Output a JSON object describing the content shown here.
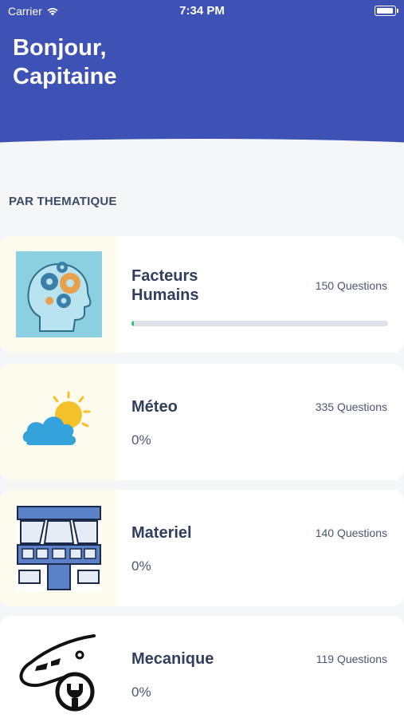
{
  "status_bar": {
    "carrier": "Carrier",
    "time": "7:34 PM"
  },
  "header": {
    "greeting": "Bonjour,\nCapitaine"
  },
  "section": {
    "label": "PAR THEMATIQUE"
  },
  "themes": [
    {
      "title": "Facteurs\nHumains",
      "count": "150 Questions",
      "progress": 0.01,
      "icon": "human-factors-gears-head-icon"
    },
    {
      "title": "Méteo",
      "count": "335 Questions",
      "percent": "0%",
      "icon": "weather-sun-cloud-icon"
    },
    {
      "title": "Materiel",
      "count": "140 Questions",
      "percent": "0%",
      "icon": "cockpit-icon"
    },
    {
      "title": "Mecanique",
      "count": "119 Questions",
      "percent": "0%",
      "icon": "plane-wrench-icon"
    }
  ],
  "colors": {
    "header": "#3e52b5",
    "progress": "#27c46d"
  }
}
